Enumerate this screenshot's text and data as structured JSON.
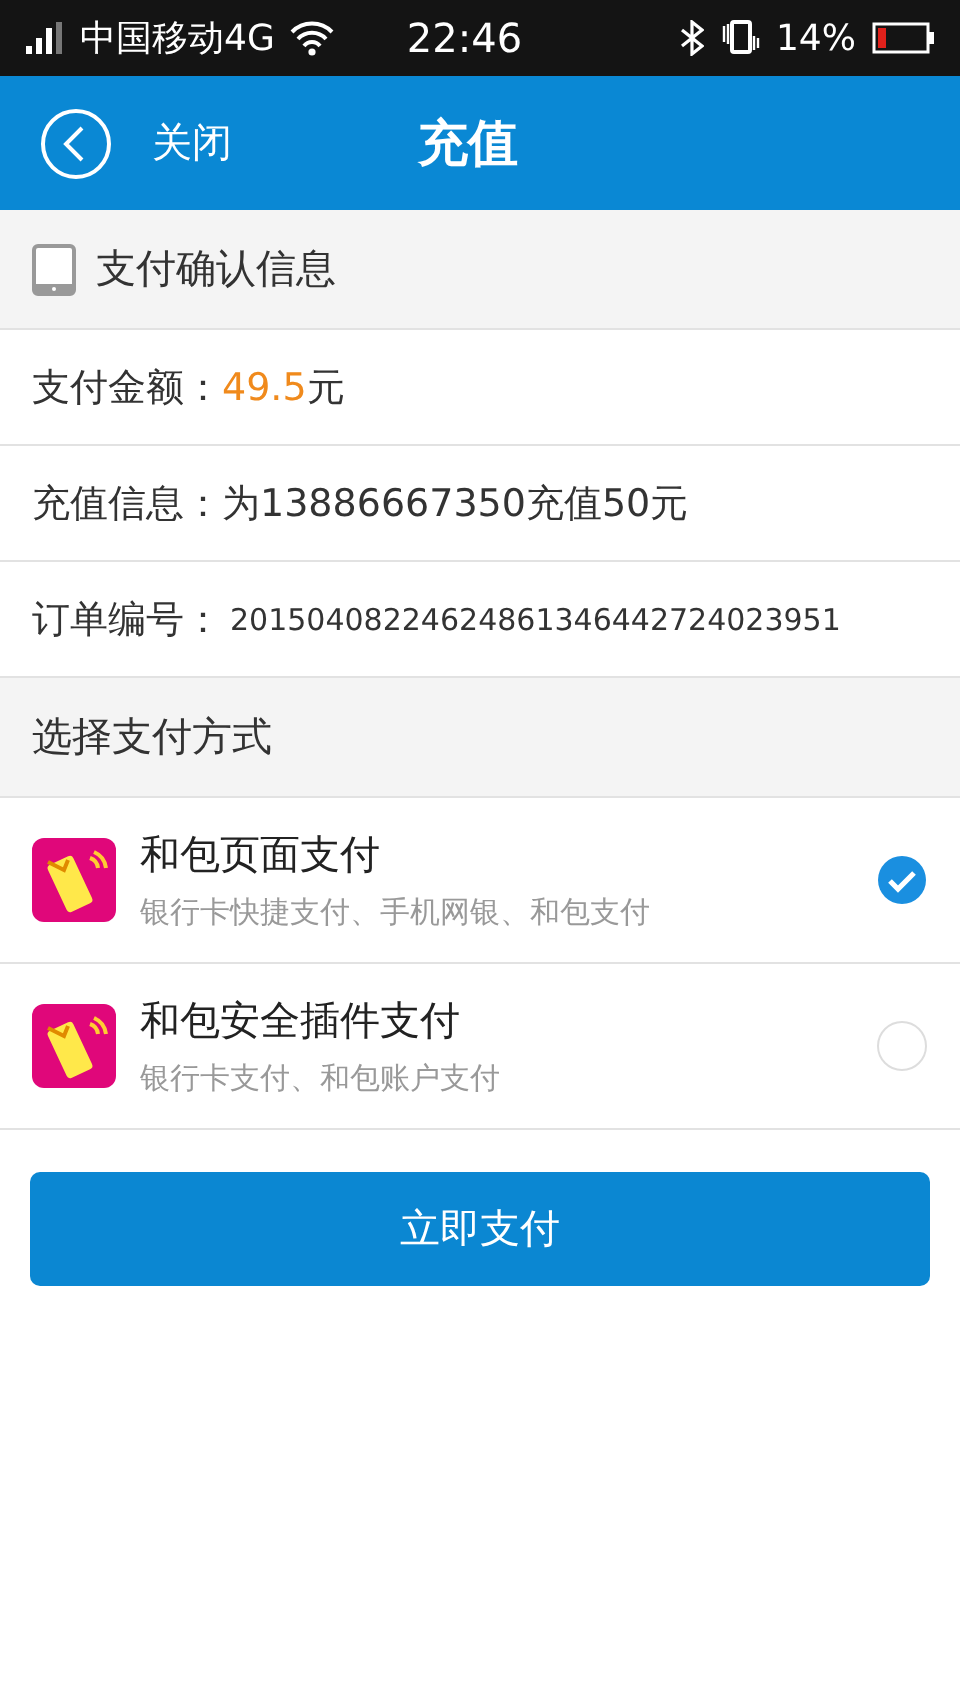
{
  "status_bar": {
    "carrier": "中国移动4G",
    "time": "22:46",
    "battery": "14%"
  },
  "header": {
    "back": "关闭",
    "title": "充值"
  },
  "confirm_section": {
    "title": "支付确认信息"
  },
  "info_rows": [
    {
      "kind": "amount",
      "label": "支付金额：",
      "value": "49.5",
      "unit": "元"
    },
    {
      "kind": "text",
      "label": "充值信息：",
      "value": "为13886667350充值50元"
    },
    {
      "kind": "code",
      "label": "订单编号：",
      "value": "20150408224624861346442724023951"
    }
  ],
  "method_section": {
    "title": "选择支付方式"
  },
  "methods": [
    {
      "name": "和包页面支付",
      "desc": "银行卡快捷支付、手机网银、和包支付",
      "selected": true
    },
    {
      "name": "和包安全插件支付",
      "desc": "银行卡支付、和包账户支付",
      "selected": false
    }
  ],
  "pay_button": "立即支付"
}
